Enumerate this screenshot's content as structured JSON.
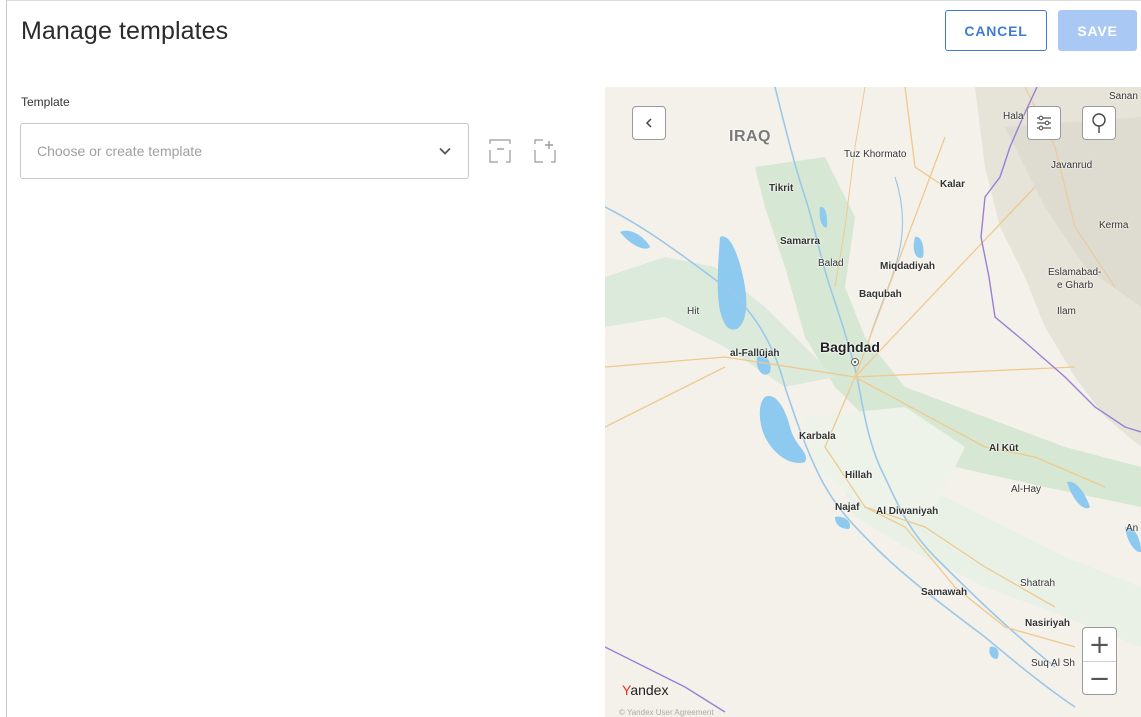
{
  "header": {
    "title": "Manage templates",
    "cancel_label": "CANCEL",
    "save_label": "SAVE"
  },
  "template": {
    "label": "Template",
    "placeholder": "Choose or create template",
    "value": ""
  },
  "icons": {
    "dropdown": "chevron-down-icon",
    "remove_template": "remove-template-icon",
    "add_template": "add-template-icon",
    "map_back": "chevron-left-icon",
    "map_filters": "sliders-icon",
    "map_pin": "map-pin-icon"
  },
  "map": {
    "country": "IRAQ",
    "cities": {
      "sanan": "Sanan",
      "hala": "Hala",
      "tuz": "Tuz Khormato",
      "javanrud": "Javanrud",
      "tikrit": "Tikrit",
      "kalar": "Kalar",
      "kerma": "Kerma",
      "samarra": "Samarra",
      "balad": "Balad",
      "miqdadiyah": "Miqdadiyah",
      "eslamabad": "Eslamabad-",
      "eslamabad2": "e Gharb",
      "baqubah": "Baqubah",
      "hit": "Hit",
      "ilam": "Ilam",
      "baghdad": "Baghdad",
      "fallujah": "al-Fallūjah",
      "karbala": "Karbala",
      "alkut": "Al Kūt",
      "hillah": "Hillah",
      "alhay": "Al-Hay",
      "najaf": "Najaf",
      "diwaniyah": "Al Diwaniyah",
      "an": "An",
      "samawah": "Samawah",
      "shatrah": "Shatrah",
      "nasiriyah": "Nasiriyah",
      "suq": "Suq Al Sh"
    },
    "zoom_in": "+",
    "zoom_out": "−",
    "brand_y": "Y",
    "brand_rest": "andex",
    "copyright": "© Yandex User Agreement"
  },
  "colors": {
    "accent": "#3f7ad6",
    "save_disabled": "#a9c8f3",
    "water": "#8ec9ef",
    "border_line": "#9b7fd6"
  }
}
